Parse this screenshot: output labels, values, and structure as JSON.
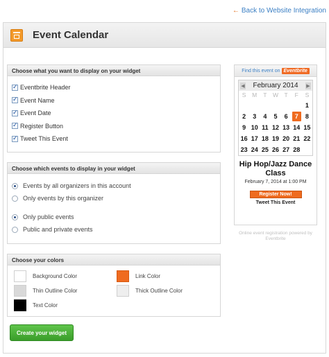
{
  "back_link": {
    "label": "Back to Website Integration",
    "icon": "back-arrow-icon"
  },
  "header": {
    "title": "Event Calendar",
    "icon": "calendar-icon"
  },
  "display_panel": {
    "heading": "Choose what you want to display on your widget",
    "items": [
      {
        "label": "Eventbrite Header",
        "checked": true
      },
      {
        "label": "Event Name",
        "checked": true
      },
      {
        "label": "Event Date",
        "checked": true
      },
      {
        "label": "Register Button",
        "checked": true
      },
      {
        "label": "Tweet This Event",
        "checked": true
      }
    ]
  },
  "events_panel": {
    "heading": "Choose which events to display in your widget",
    "organizer_options": [
      {
        "label": "Events by all organizers in this account",
        "selected": true
      },
      {
        "label": "Only events by this organizer",
        "selected": false
      }
    ],
    "privacy_options": [
      {
        "label": "Only public events",
        "selected": true
      },
      {
        "label": "Public and private events",
        "selected": false
      }
    ]
  },
  "colors_panel": {
    "heading": "Choose your colors",
    "background": {
      "label": "Background Color",
      "color": "#ffffff"
    },
    "link": {
      "label": "Link Color",
      "color": "#ef6b1f"
    },
    "thin_outline": {
      "label": "Thin Outline Color",
      "color": "#d9d9d9"
    },
    "thick_outline": {
      "label": "Thick Outline Color",
      "color": "#eeeeee"
    },
    "text": {
      "label": "Text Color",
      "color": "#000000"
    }
  },
  "create_button": {
    "label": "Create your widget"
  },
  "widget": {
    "find_text": "Find this event on",
    "brand": "Eventbrite",
    "calendar": {
      "month": "February 2014",
      "weekdays": [
        "S",
        "M",
        "T",
        "W",
        "T",
        "F",
        "S"
      ],
      "days": [
        "",
        "",
        "",
        "",
        "",
        "",
        "1",
        "2",
        "3",
        "4",
        "5",
        "6",
        "7",
        "8",
        "9",
        "10",
        "11",
        "12",
        "13",
        "14",
        "15",
        "16",
        "17",
        "18",
        "19",
        "20",
        "21",
        "22",
        "23",
        "24",
        "25",
        "26",
        "27",
        "28",
        ""
      ],
      "selected_day": "7"
    },
    "event_title": "Hip Hop/Jazz Dance Class",
    "event_date": "February 7, 2014 at 1:00 PM",
    "register_label": "Register Now!",
    "tweet_label": "Tweet This Event",
    "powered_by": "Online event registration powered by Eventbrite"
  },
  "accent_colors": {
    "link_blue": "#3b7fc4",
    "eventbrite_orange": "#ef6b1f",
    "button_green": "#3a9d2a"
  }
}
